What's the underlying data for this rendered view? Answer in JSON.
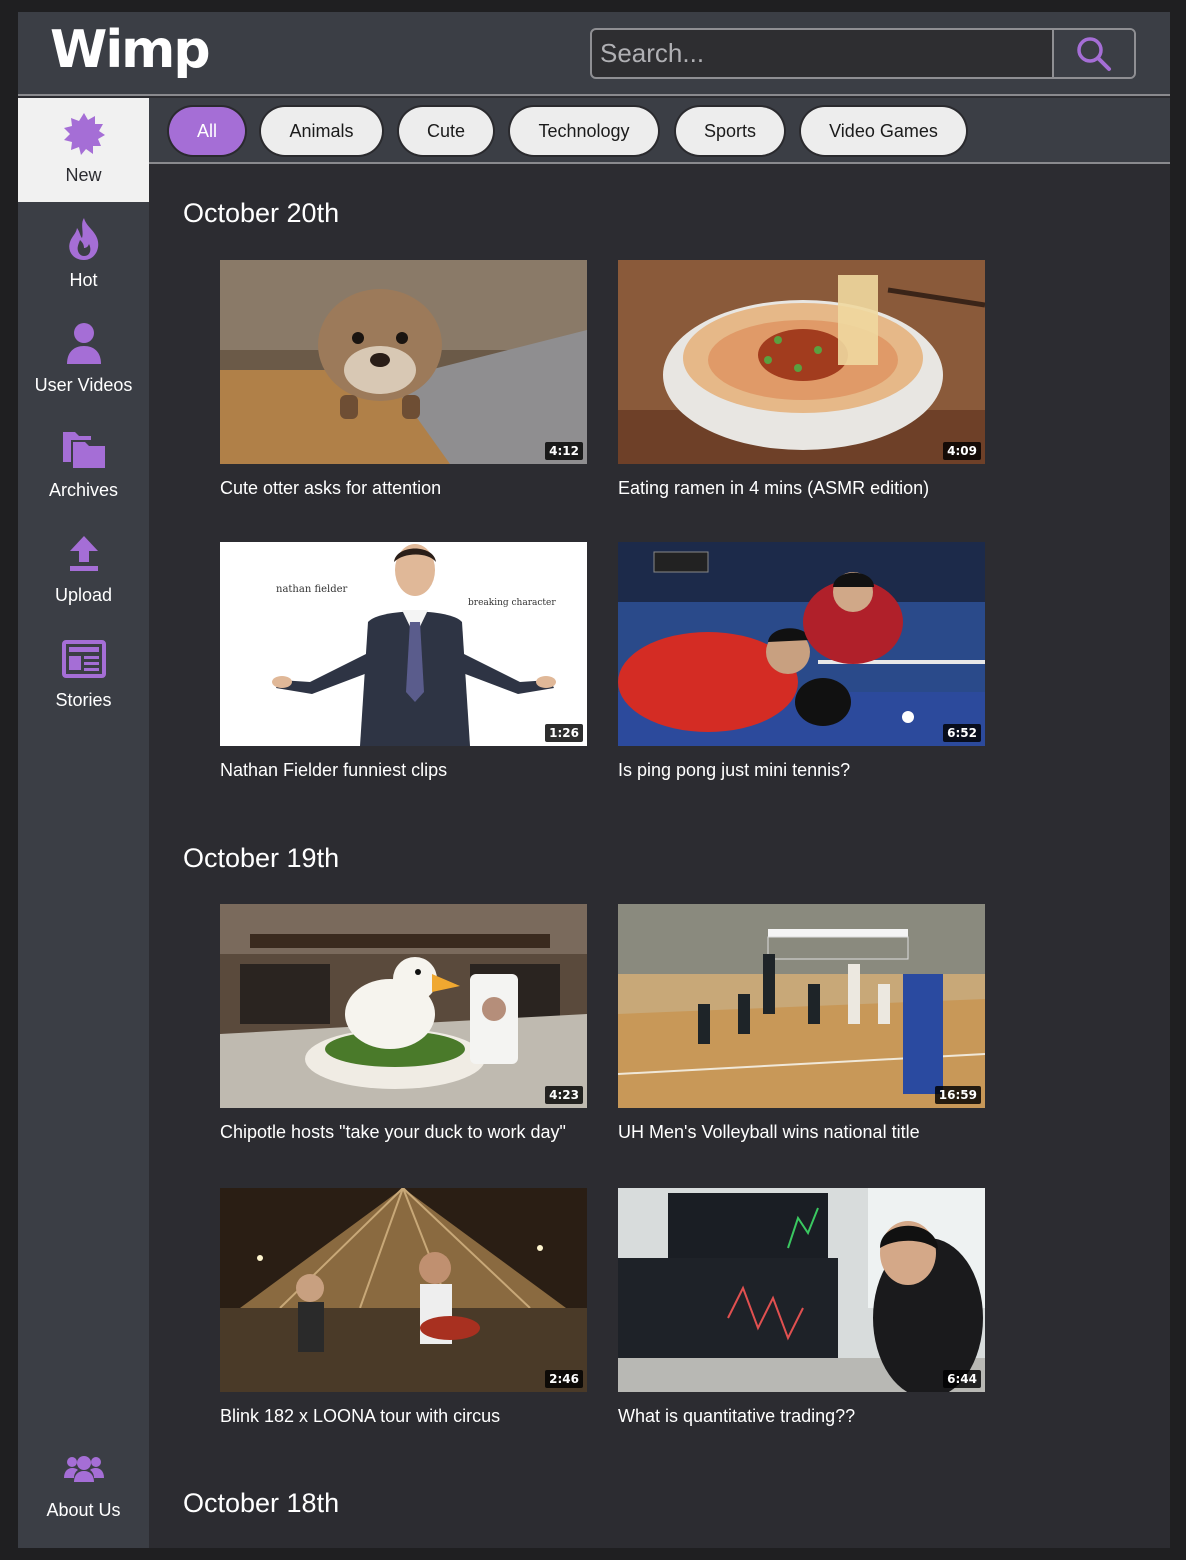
{
  "app": {
    "logo": "Wimp",
    "search": {
      "placeholder": "Search..."
    }
  },
  "sidebar": {
    "items": [
      {
        "label": "New",
        "icon": "starburst-icon",
        "active": true
      },
      {
        "label": "Hot",
        "icon": "flame-icon"
      },
      {
        "label": "User Videos",
        "icon": "user-icon"
      },
      {
        "label": "Archives",
        "icon": "folders-icon"
      },
      {
        "label": "Upload",
        "icon": "upload-icon"
      },
      {
        "label": "Stories",
        "icon": "newspaper-icon"
      }
    ],
    "about": {
      "label": "About Us",
      "icon": "users-icon"
    }
  },
  "categories": [
    "All",
    "Animals",
    "Cute",
    "Technology",
    "Sports",
    "Video Games"
  ],
  "active_category": "All",
  "accent_color": "#a56ed6",
  "sections": [
    {
      "date": "October 20th",
      "videos": [
        {
          "title": "Cute otter asks for attention",
          "duration": "4:12",
          "thumb": "otter"
        },
        {
          "title": "Eating ramen in 4 mins (ASMR edition)",
          "duration": "4:09",
          "thumb": "ramen"
        },
        {
          "title": "Nathan Fielder funniest clips",
          "duration": "1:26",
          "thumb": "fielder",
          "thumb_text": [
            "nathan fielder",
            "breaking character"
          ]
        },
        {
          "title": "Is ping pong just mini tennis?",
          "duration": "6:52",
          "thumb": "pingpong"
        }
      ]
    },
    {
      "date": "October 19th",
      "videos": [
        {
          "title": "Chipotle hosts \"take your duck to work day\"",
          "duration": "4:23",
          "thumb": "duck"
        },
        {
          "title": "UH Men's Volleyball wins national title",
          "duration": "16:59",
          "thumb": "volleyball"
        },
        {
          "title": "Blink 182 x LOONA tour with circus",
          "duration": "2:46",
          "thumb": "concert"
        },
        {
          "title": "What is quantitative trading??",
          "duration": "6:44",
          "thumb": "trading"
        }
      ]
    },
    {
      "date": "October 18th",
      "videos": []
    }
  ]
}
